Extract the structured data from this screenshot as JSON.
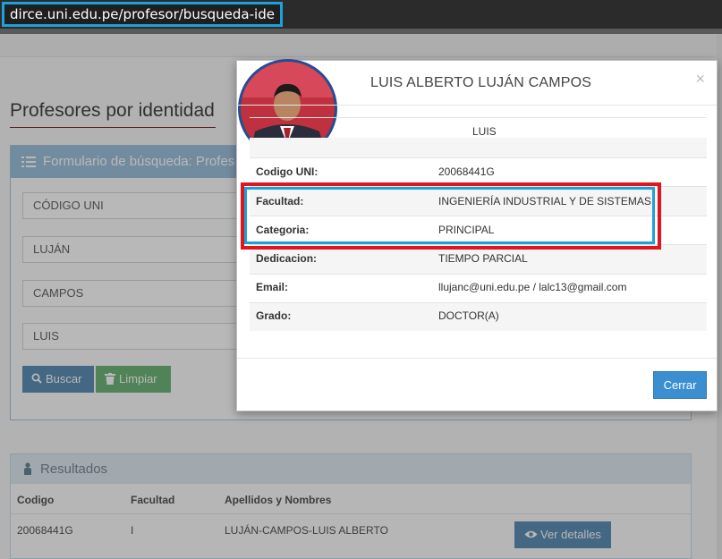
{
  "browser": {
    "url": "dirce.uni.edu.pe/profesor/busqueda-ide"
  },
  "page": {
    "title": "Profesores por identidad",
    "form": {
      "header": "Formulario de búsqueda: Profes",
      "fields": [
        "CÓDIGO UNI",
        "LUJÁN",
        "CAMPOS",
        "LUIS"
      ],
      "search_label": "Buscar",
      "clear_label": "Limpiar"
    },
    "results": {
      "header": "Resultados",
      "columns": [
        "Codigo",
        "Facultad",
        "Apellidos y Nombres"
      ],
      "rows": [
        {
          "codigo": "20068441G",
          "facultad": "I",
          "nombres": "LUJÁN-CAMPOS-LUIS ALBERTO",
          "action": "Ver detalles"
        }
      ]
    }
  },
  "modal": {
    "title": "LUIS ALBERTO LUJÁN CAMPOS",
    "close_glyph": "×",
    "name_value": "LUIS",
    "details": [
      {
        "label": "Codigo UNI:",
        "value": "20068441G"
      },
      {
        "label": "Facultad:",
        "value": "INGENIERÍA INDUSTRIAL Y DE SISTEMAS"
      },
      {
        "label": "Categoria:",
        "value": "PRINCIPAL"
      },
      {
        "label": "Dedicacion:",
        "value": "TIEMPO PARCIAL"
      },
      {
        "label": "Email:",
        "value": "llujanc@uni.edu.pe / lalc13@gmail.com"
      },
      {
        "label": "Grado:",
        "value": "DOCTOR(A)"
      }
    ],
    "close_label": "Cerrar"
  },
  "icons": {
    "form_header": "list-check-icon",
    "search": "search-icon",
    "clear": "trash-icon",
    "results_header": "user-icon",
    "details": "eye-icon",
    "close": "close-icon"
  },
  "colors": {
    "highlight_blue": "#1ea0d8",
    "highlight_red": "#e0161f",
    "primary_button": "#3b8fd0",
    "success_button": "#6fb87b"
  }
}
